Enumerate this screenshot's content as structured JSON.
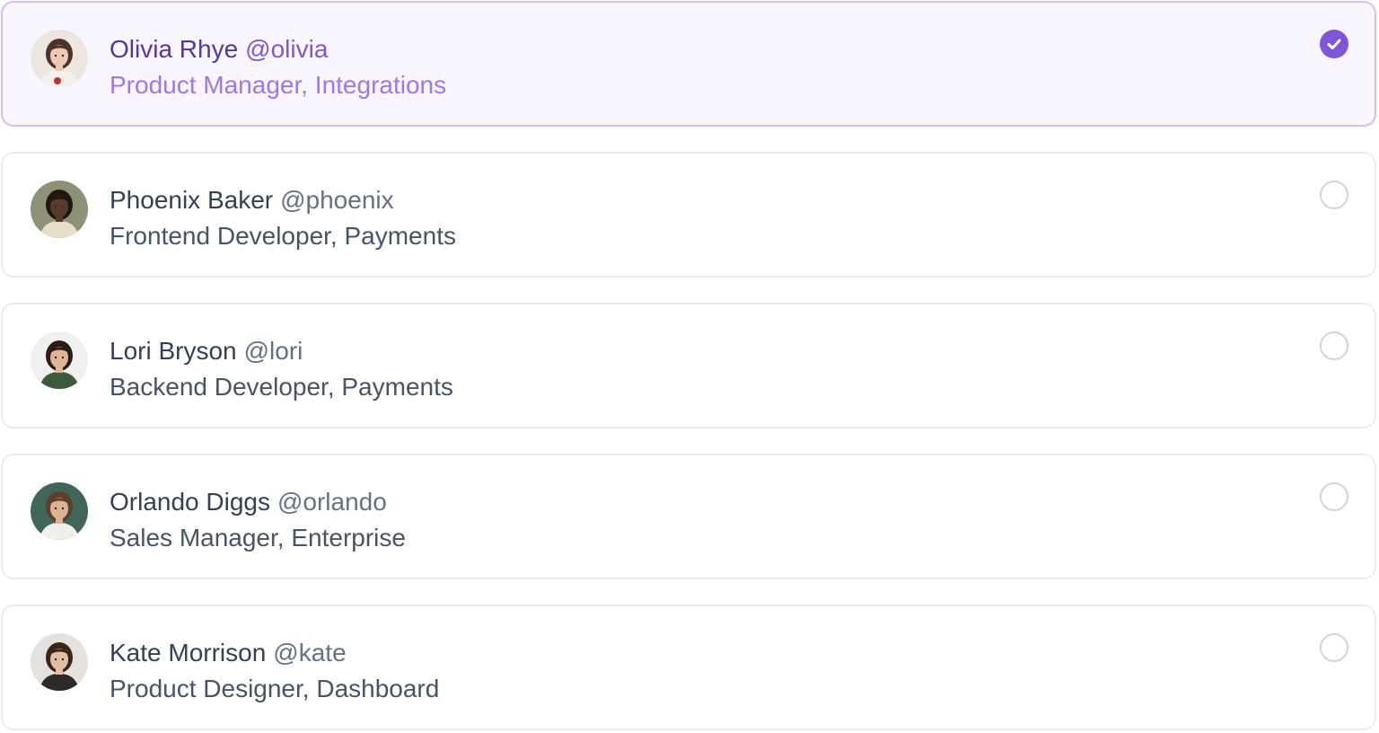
{
  "members": [
    {
      "name": "Olivia Rhye",
      "handle": "@olivia",
      "role": "Product Manager, Integrations",
      "selected": true,
      "avatar": {
        "bg": "#ECE6DF",
        "skin": "#EBC9B3",
        "hair": "#4A3328",
        "clothes": "#F4F1EC",
        "accent": "#C2332B"
      }
    },
    {
      "name": "Phoenix Baker",
      "handle": "@phoenix",
      "role": "Frontend Developer, Payments",
      "selected": false,
      "avatar": {
        "bg": "#8F9176",
        "skin": "#5A3A28",
        "hair": "#1E1712",
        "clothes": "#E6DEC9",
        "accent": "#2B2B2B"
      }
    },
    {
      "name": "Lori Bryson",
      "handle": "@lori",
      "role": "Backend Developer, Payments",
      "selected": false,
      "avatar": {
        "bg": "#F2F0EE",
        "skin": "#E0B596",
        "hair": "#2A1B14",
        "clothes": "#3D5A3A",
        "accent": "#2E2E2E"
      }
    },
    {
      "name": "Orlando Diggs",
      "handle": "@orlando",
      "role": "Sales Manager, Enterprise",
      "selected": false,
      "avatar": {
        "bg": "#3F6659",
        "skin": "#DDB293",
        "hair": "#5E3F27",
        "clothes": "#F1EFEB",
        "accent": "#2E2E2E"
      }
    },
    {
      "name": "Kate Morrison",
      "handle": "@kate",
      "role": "Product Designer, Dashboard",
      "selected": false,
      "avatar": {
        "bg": "#E4E1DE",
        "skin": "#E2BEA4",
        "hair": "#3A2519",
        "clothes": "#2D2A28",
        "accent": "#2E2E2E"
      }
    }
  ],
  "colors": {
    "brand": "#7F56D9",
    "selected_bg": "#F9F5FF",
    "selected_border": "#D6BBFB",
    "border": "#EAECF0"
  },
  "icons": {
    "checked": "check-icon"
  }
}
